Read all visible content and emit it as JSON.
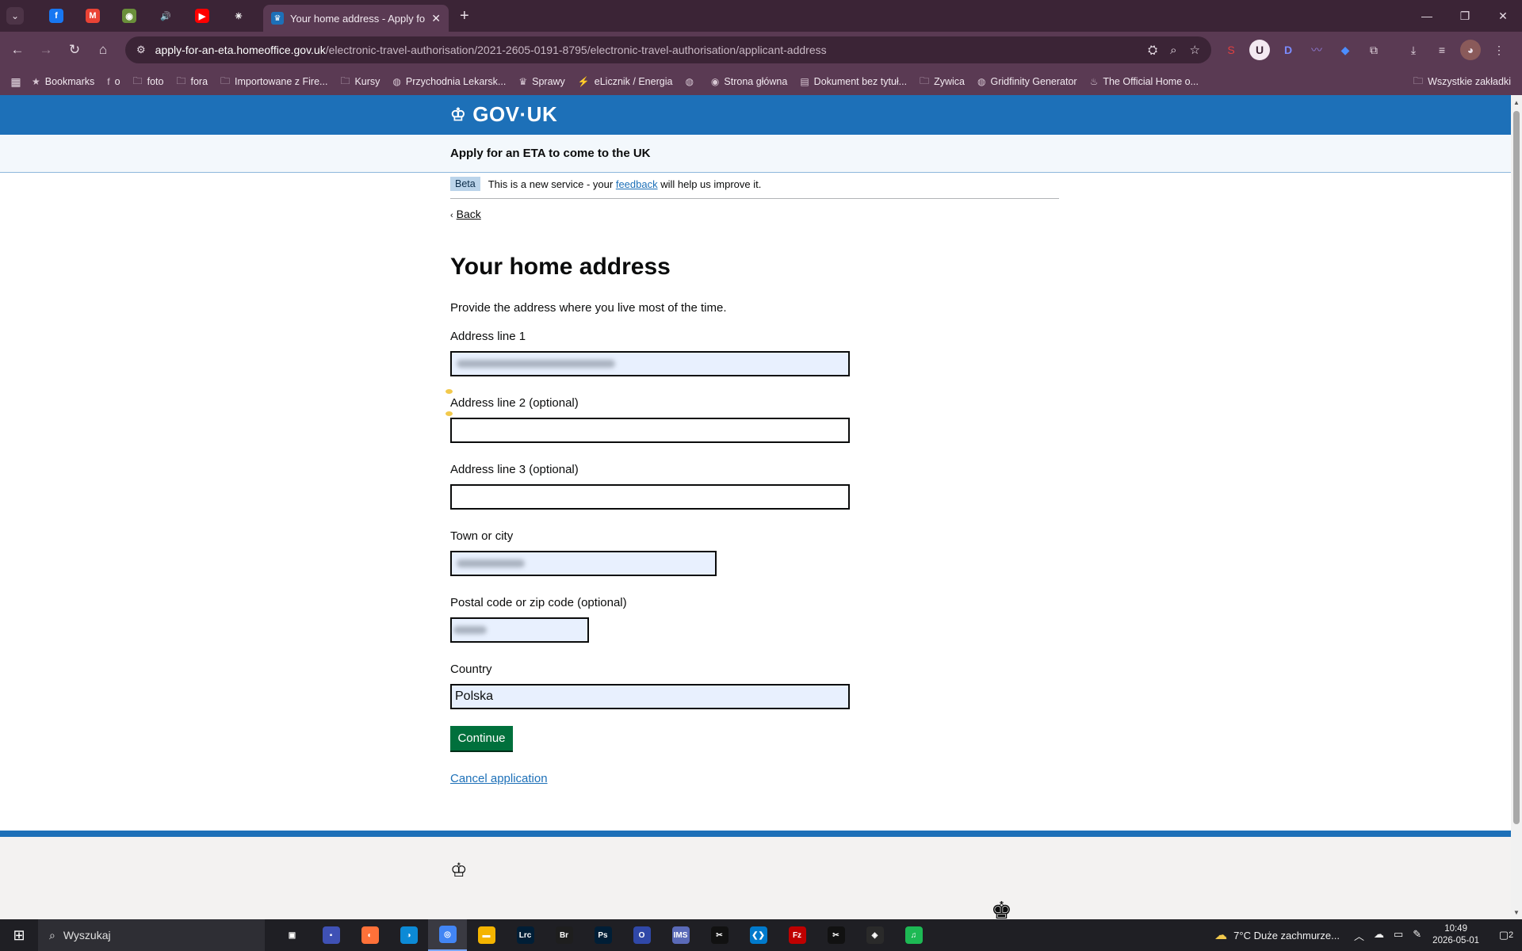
{
  "browser": {
    "pinned_tabs": [
      {
        "icon": "facebook-icon",
        "glyph": "f",
        "color": "#1877f2"
      },
      {
        "icon": "gmail-icon",
        "glyph": "M",
        "color": "#ea4335"
      },
      {
        "icon": "app-icon",
        "glyph": "◉",
        "color": "#6a8f3a"
      },
      {
        "icon": "speaker-icon",
        "glyph": "🔊",
        "color": "transparent"
      },
      {
        "icon": "youtube-icon",
        "glyph": "▶",
        "color": "#ff0000"
      },
      {
        "icon": "claude-icon",
        "glyph": "✳",
        "color": "transparent"
      }
    ],
    "active_tab_title": "Your home address - Apply fo",
    "url_host": "apply-for-an-eta.homeoffice.gov.uk",
    "url_path": "/electronic-travel-authorisation/2021-2605-0191-8795/electronic-travel-authorisation/applicant-address",
    "bookmarks": [
      {
        "label": "Bookmarks",
        "icon": "star-icon",
        "glyph": "★"
      },
      {
        "label": "o",
        "icon": "facebook-icon",
        "glyph": "f"
      },
      {
        "label": "foto",
        "icon": "folder-icon",
        "glyph": "🗀"
      },
      {
        "label": "fora",
        "icon": "folder-icon",
        "glyph": "🗀"
      },
      {
        "label": "Importowane z Fire...",
        "icon": "folder-icon",
        "glyph": "🗀"
      },
      {
        "label": "Kursy",
        "icon": "folder-icon",
        "glyph": "🗀"
      },
      {
        "label": "Przychodnia Lekarsk...",
        "icon": "globe-icon",
        "glyph": "◍"
      },
      {
        "label": "Sprawy",
        "icon": "eagle-icon",
        "glyph": "♛"
      },
      {
        "label": "eLicznik / Energia",
        "icon": "energy-icon",
        "glyph": "⚡"
      },
      {
        "label": "",
        "icon": "globe-icon",
        "glyph": "◍"
      },
      {
        "label": "Strona główna",
        "icon": "globe-icon",
        "glyph": "◉"
      },
      {
        "label": "Dokument bez tytuł...",
        "icon": "docs-icon",
        "glyph": "▤"
      },
      {
        "label": "Zywica",
        "icon": "folder-icon",
        "glyph": "🗀"
      },
      {
        "label": "Gridfinity Generator",
        "icon": "globe-icon",
        "glyph": "◍"
      },
      {
        "label": "The Official Home o...",
        "icon": "home-site-icon",
        "glyph": "♨"
      }
    ],
    "all_bookmarks": "Wszystkie zakładki"
  },
  "page": {
    "logo": "GOV·UK",
    "service_name": "Apply for an ETA to come to the UK",
    "phase_tag": "Beta",
    "phase_text_before": "This is a new service - your ",
    "phase_link": "feedback",
    "phase_text_after": " will help us improve it.",
    "back": "Back",
    "heading": "Your home address",
    "hint": "Provide the address where you live most of the time.",
    "fields": {
      "address1_label": "Address line 1",
      "address2_label": "Address line 2 (optional)",
      "address3_label": "Address line 3 (optional)",
      "town_label": "Town or city",
      "postcode_label": "Postal code or zip code (optional)",
      "country_label": "Country",
      "country_value": "Polska"
    },
    "continue": "Continue",
    "cancel": "Cancel application"
  },
  "taskbar": {
    "search_placeholder": "Wyszukaj",
    "apps": [
      {
        "icon": "task-view-icon",
        "glyph": "▣",
        "color": "transparent"
      },
      {
        "icon": "save-app-icon",
        "glyph": "▪",
        "color": "#3f51b5"
      },
      {
        "icon": "firefox-icon",
        "glyph": "◐",
        "color": "#ff7139"
      },
      {
        "icon": "edge-icon",
        "glyph": "◑",
        "color": "#0c8ad6"
      },
      {
        "icon": "chrome-icon",
        "glyph": "◎",
        "color": "#4285f4"
      },
      {
        "icon": "file-explorer-icon",
        "glyph": "▬",
        "color": "#f4b400"
      },
      {
        "icon": "lightroom-icon",
        "glyph": "Lrc",
        "color": "#001e36"
      },
      {
        "icon": "bridge-icon",
        "glyph": "Br",
        "color": "#1e1e1e"
      },
      {
        "icon": "photoshop-icon",
        "glyph": "Ps",
        "color": "#001e36"
      },
      {
        "icon": "app-o-icon",
        "glyph": "O",
        "color": "#3048a8"
      },
      {
        "icon": "ims-icon",
        "glyph": "IMS",
        "color": "#5a6ab8"
      },
      {
        "icon": "capcut-icon",
        "glyph": "✂",
        "color": "#111111"
      },
      {
        "icon": "vscode-icon",
        "glyph": "❮❯",
        "color": "#007acc"
      },
      {
        "icon": "filezilla-icon",
        "glyph": "Fz",
        "color": "#bf0000"
      },
      {
        "icon": "capcut2-icon",
        "glyph": "✂",
        "color": "#111111"
      },
      {
        "icon": "davinci-icon",
        "glyph": "◈",
        "color": "#2a2a2a"
      },
      {
        "icon": "spotify-icon",
        "glyph": "♫",
        "color": "#1db954"
      }
    ],
    "weather": "7°C  Duże zachmurze...",
    "time": "10:49",
    "date": "2026-05-01",
    "notifications": "2"
  }
}
